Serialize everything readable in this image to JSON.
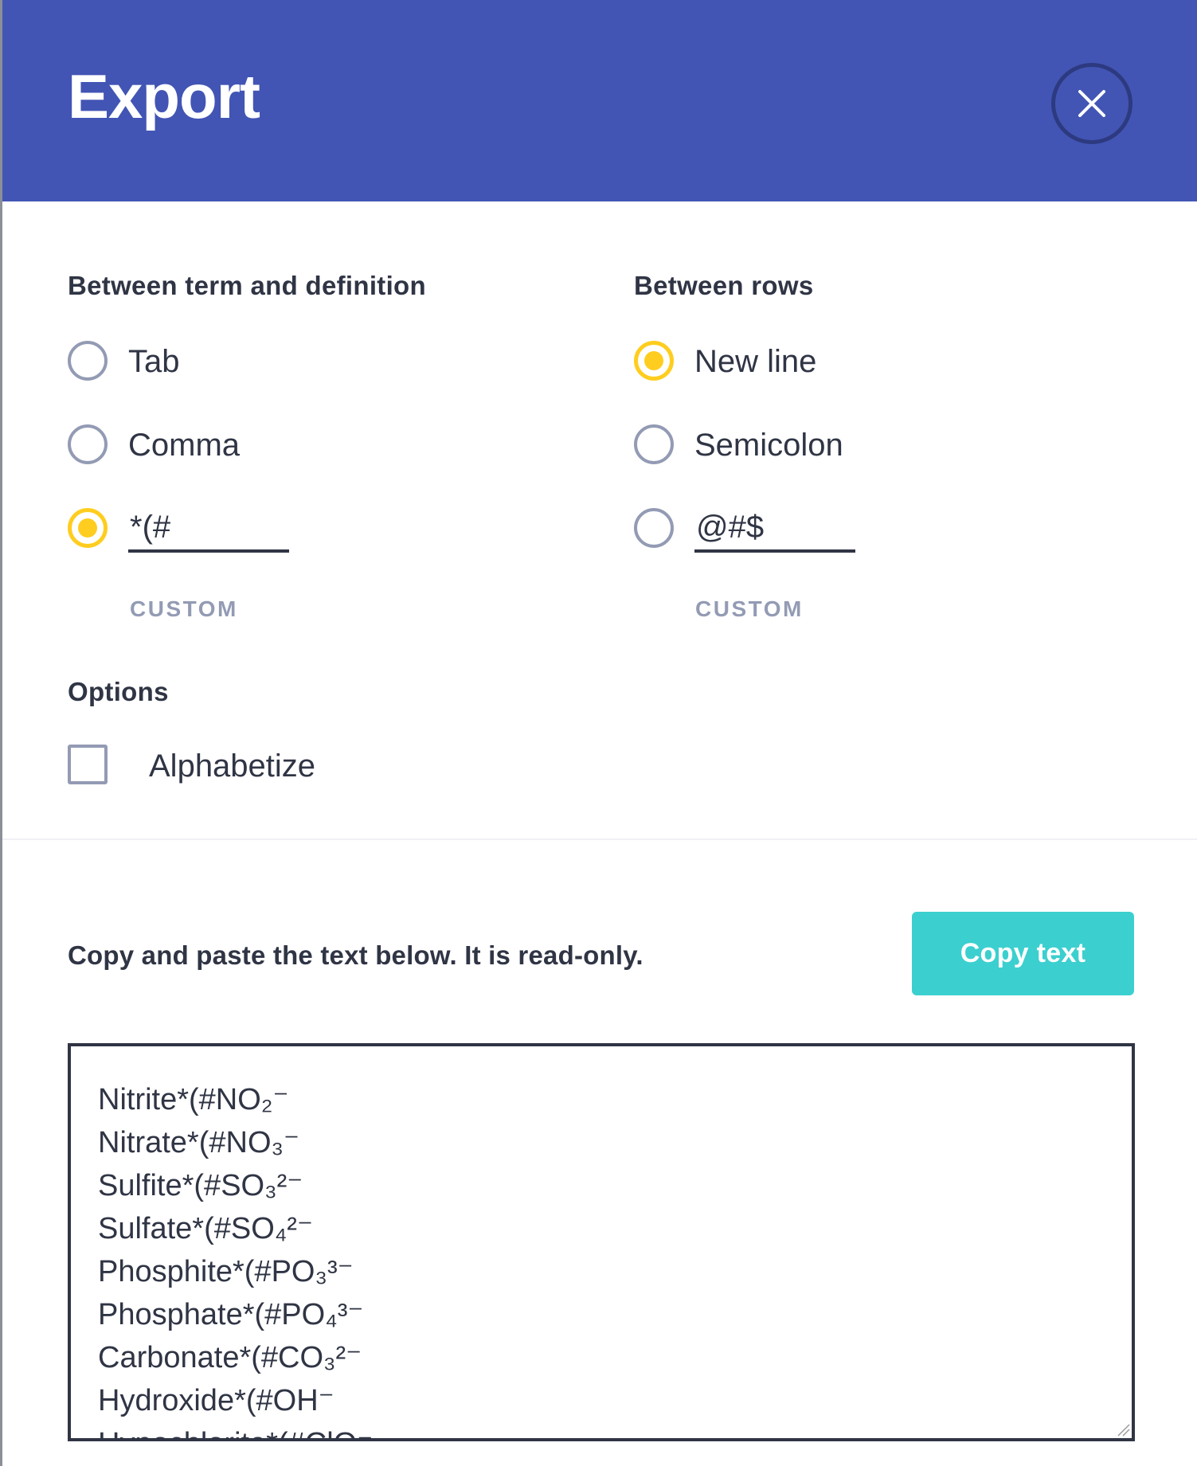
{
  "header": {
    "title": "Export",
    "close_icon": "close-icon"
  },
  "term_definition": {
    "label": "Between term and definition",
    "options": [
      {
        "label": "Tab",
        "checked": false
      },
      {
        "label": "Comma",
        "checked": false
      }
    ],
    "custom": {
      "value": "*(#",
      "checked": true,
      "caption": "CUSTOM"
    }
  },
  "rows": {
    "label": "Between rows",
    "options": [
      {
        "label": "New line",
        "checked": true
      },
      {
        "label": "Semicolon",
        "checked": false
      }
    ],
    "custom": {
      "value": "@#$",
      "checked": false,
      "caption": "CUSTOM"
    }
  },
  "options": {
    "label": "Options",
    "alphabetize": {
      "label": "Alphabetize",
      "checked": false
    }
  },
  "output": {
    "instruction": "Copy and paste the text below. It is read-only.",
    "copy_button": "Copy text",
    "lines": [
      "Nitrite*(#NO₂⁻",
      "Nitrate*(#NO₃⁻",
      "Sulfite*(#SO₃²⁻",
      "Sulfate*(#SO₄²⁻",
      "Phosphite*(#PO₃³⁻",
      "Phosphate*(#PO₄³⁻",
      "Carbonate*(#CO₃²⁻",
      "Hydroxide*(#OH⁻",
      "Hypochlorite*(#ClO⁻"
    ]
  },
  "colors": {
    "header_bg": "#4255b4",
    "accent_yellow": "#ffcd1f",
    "button_teal": "#3ccfcf",
    "text_dark": "#303545",
    "muted": "#939bb4"
  }
}
